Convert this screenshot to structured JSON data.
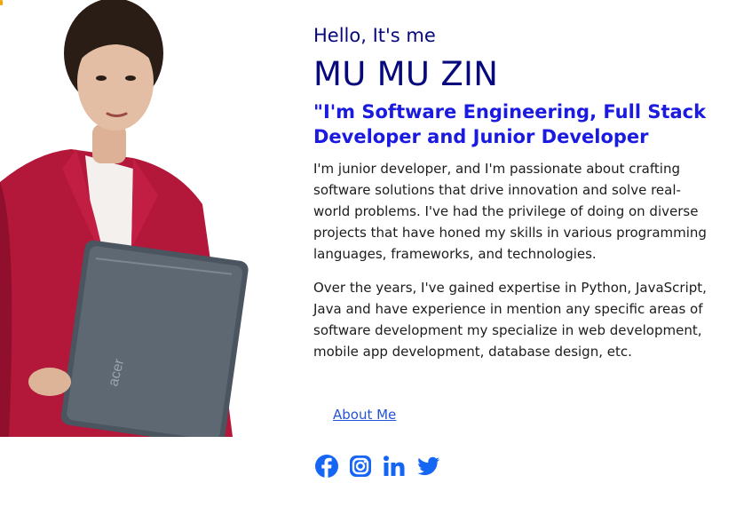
{
  "hero": {
    "greeting": "Hello, It's me",
    "name": "MU MU ZIN",
    "role": "\"I'm Software Engineering, Full Stack Developer and Junior Developer",
    "paragraphs": [
      "I'm junior developer, and I'm passionate about crafting software solutions that drive innovation and solve real-world problems. I've had the privilege of doing on diverse projects that have honed my skills in various programming languages, frameworks, and technologies.",
      "Over the years, I've gained expertise in Python, JavaScript, Java and have experience in mention any specific areas of software development my specialize in web development, mobile app development, database design, etc."
    ],
    "about_link": "About Me",
    "laptop_brand": "acer"
  },
  "socials": [
    {
      "icon": "facebook-icon"
    },
    {
      "icon": "instagram-icon"
    },
    {
      "icon": "linkedin-icon"
    },
    {
      "icon": "twitter-icon"
    }
  ],
  "colors": {
    "heading": "#07087c",
    "accent": "#1a1ae0",
    "link": "#2453d6",
    "social": "#1666f5"
  }
}
